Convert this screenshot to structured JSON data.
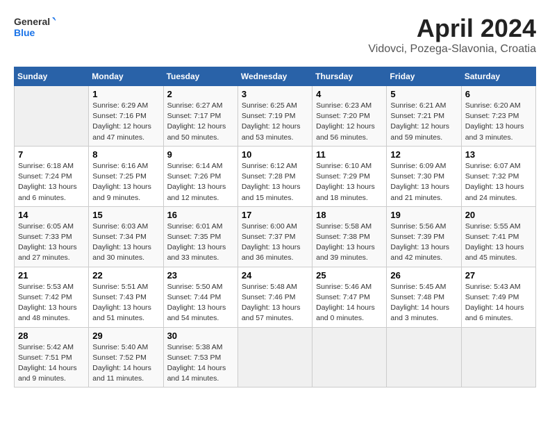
{
  "header": {
    "logo_general": "General",
    "logo_blue": "Blue",
    "title": "April 2024",
    "subtitle": "Vidovci, Pozega-Slavonia, Croatia"
  },
  "days_of_week": [
    "Sunday",
    "Monday",
    "Tuesday",
    "Wednesday",
    "Thursday",
    "Friday",
    "Saturday"
  ],
  "weeks": [
    {
      "days": [
        {
          "number": "",
          "empty": true
        },
        {
          "number": "1",
          "sunrise": "Sunrise: 6:29 AM",
          "sunset": "Sunset: 7:16 PM",
          "daylight": "Daylight: 12 hours and 47 minutes."
        },
        {
          "number": "2",
          "sunrise": "Sunrise: 6:27 AM",
          "sunset": "Sunset: 7:17 PM",
          "daylight": "Daylight: 12 hours and 50 minutes."
        },
        {
          "number": "3",
          "sunrise": "Sunrise: 6:25 AM",
          "sunset": "Sunset: 7:19 PM",
          "daylight": "Daylight: 12 hours and 53 minutes."
        },
        {
          "number": "4",
          "sunrise": "Sunrise: 6:23 AM",
          "sunset": "Sunset: 7:20 PM",
          "daylight": "Daylight: 12 hours and 56 minutes."
        },
        {
          "number": "5",
          "sunrise": "Sunrise: 6:21 AM",
          "sunset": "Sunset: 7:21 PM",
          "daylight": "Daylight: 12 hours and 59 minutes."
        },
        {
          "number": "6",
          "sunrise": "Sunrise: 6:20 AM",
          "sunset": "Sunset: 7:23 PM",
          "daylight": "Daylight: 13 hours and 3 minutes."
        }
      ]
    },
    {
      "days": [
        {
          "number": "7",
          "sunrise": "Sunrise: 6:18 AM",
          "sunset": "Sunset: 7:24 PM",
          "daylight": "Daylight: 13 hours and 6 minutes."
        },
        {
          "number": "8",
          "sunrise": "Sunrise: 6:16 AM",
          "sunset": "Sunset: 7:25 PM",
          "daylight": "Daylight: 13 hours and 9 minutes."
        },
        {
          "number": "9",
          "sunrise": "Sunrise: 6:14 AM",
          "sunset": "Sunset: 7:26 PM",
          "daylight": "Daylight: 13 hours and 12 minutes."
        },
        {
          "number": "10",
          "sunrise": "Sunrise: 6:12 AM",
          "sunset": "Sunset: 7:28 PM",
          "daylight": "Daylight: 13 hours and 15 minutes."
        },
        {
          "number": "11",
          "sunrise": "Sunrise: 6:10 AM",
          "sunset": "Sunset: 7:29 PM",
          "daylight": "Daylight: 13 hours and 18 minutes."
        },
        {
          "number": "12",
          "sunrise": "Sunrise: 6:09 AM",
          "sunset": "Sunset: 7:30 PM",
          "daylight": "Daylight: 13 hours and 21 minutes."
        },
        {
          "number": "13",
          "sunrise": "Sunrise: 6:07 AM",
          "sunset": "Sunset: 7:32 PM",
          "daylight": "Daylight: 13 hours and 24 minutes."
        }
      ]
    },
    {
      "days": [
        {
          "number": "14",
          "sunrise": "Sunrise: 6:05 AM",
          "sunset": "Sunset: 7:33 PM",
          "daylight": "Daylight: 13 hours and 27 minutes."
        },
        {
          "number": "15",
          "sunrise": "Sunrise: 6:03 AM",
          "sunset": "Sunset: 7:34 PM",
          "daylight": "Daylight: 13 hours and 30 minutes."
        },
        {
          "number": "16",
          "sunrise": "Sunrise: 6:01 AM",
          "sunset": "Sunset: 7:35 PM",
          "daylight": "Daylight: 13 hours and 33 minutes."
        },
        {
          "number": "17",
          "sunrise": "Sunrise: 6:00 AM",
          "sunset": "Sunset: 7:37 PM",
          "daylight": "Daylight: 13 hours and 36 minutes."
        },
        {
          "number": "18",
          "sunrise": "Sunrise: 5:58 AM",
          "sunset": "Sunset: 7:38 PM",
          "daylight": "Daylight: 13 hours and 39 minutes."
        },
        {
          "number": "19",
          "sunrise": "Sunrise: 5:56 AM",
          "sunset": "Sunset: 7:39 PM",
          "daylight": "Daylight: 13 hours and 42 minutes."
        },
        {
          "number": "20",
          "sunrise": "Sunrise: 5:55 AM",
          "sunset": "Sunset: 7:41 PM",
          "daylight": "Daylight: 13 hours and 45 minutes."
        }
      ]
    },
    {
      "days": [
        {
          "number": "21",
          "sunrise": "Sunrise: 5:53 AM",
          "sunset": "Sunset: 7:42 PM",
          "daylight": "Daylight: 13 hours and 48 minutes."
        },
        {
          "number": "22",
          "sunrise": "Sunrise: 5:51 AM",
          "sunset": "Sunset: 7:43 PM",
          "daylight": "Daylight: 13 hours and 51 minutes."
        },
        {
          "number": "23",
          "sunrise": "Sunrise: 5:50 AM",
          "sunset": "Sunset: 7:44 PM",
          "daylight": "Daylight: 13 hours and 54 minutes."
        },
        {
          "number": "24",
          "sunrise": "Sunrise: 5:48 AM",
          "sunset": "Sunset: 7:46 PM",
          "daylight": "Daylight: 13 hours and 57 minutes."
        },
        {
          "number": "25",
          "sunrise": "Sunrise: 5:46 AM",
          "sunset": "Sunset: 7:47 PM",
          "daylight": "Daylight: 14 hours and 0 minutes."
        },
        {
          "number": "26",
          "sunrise": "Sunrise: 5:45 AM",
          "sunset": "Sunset: 7:48 PM",
          "daylight": "Daylight: 14 hours and 3 minutes."
        },
        {
          "number": "27",
          "sunrise": "Sunrise: 5:43 AM",
          "sunset": "Sunset: 7:49 PM",
          "daylight": "Daylight: 14 hours and 6 minutes."
        }
      ]
    },
    {
      "days": [
        {
          "number": "28",
          "sunrise": "Sunrise: 5:42 AM",
          "sunset": "Sunset: 7:51 PM",
          "daylight": "Daylight: 14 hours and 9 minutes."
        },
        {
          "number": "29",
          "sunrise": "Sunrise: 5:40 AM",
          "sunset": "Sunset: 7:52 PM",
          "daylight": "Daylight: 14 hours and 11 minutes."
        },
        {
          "number": "30",
          "sunrise": "Sunrise: 5:38 AM",
          "sunset": "Sunset: 7:53 PM",
          "daylight": "Daylight: 14 hours and 14 minutes."
        },
        {
          "number": "",
          "empty": true
        },
        {
          "number": "",
          "empty": true
        },
        {
          "number": "",
          "empty": true
        },
        {
          "number": "",
          "empty": true
        }
      ]
    }
  ]
}
